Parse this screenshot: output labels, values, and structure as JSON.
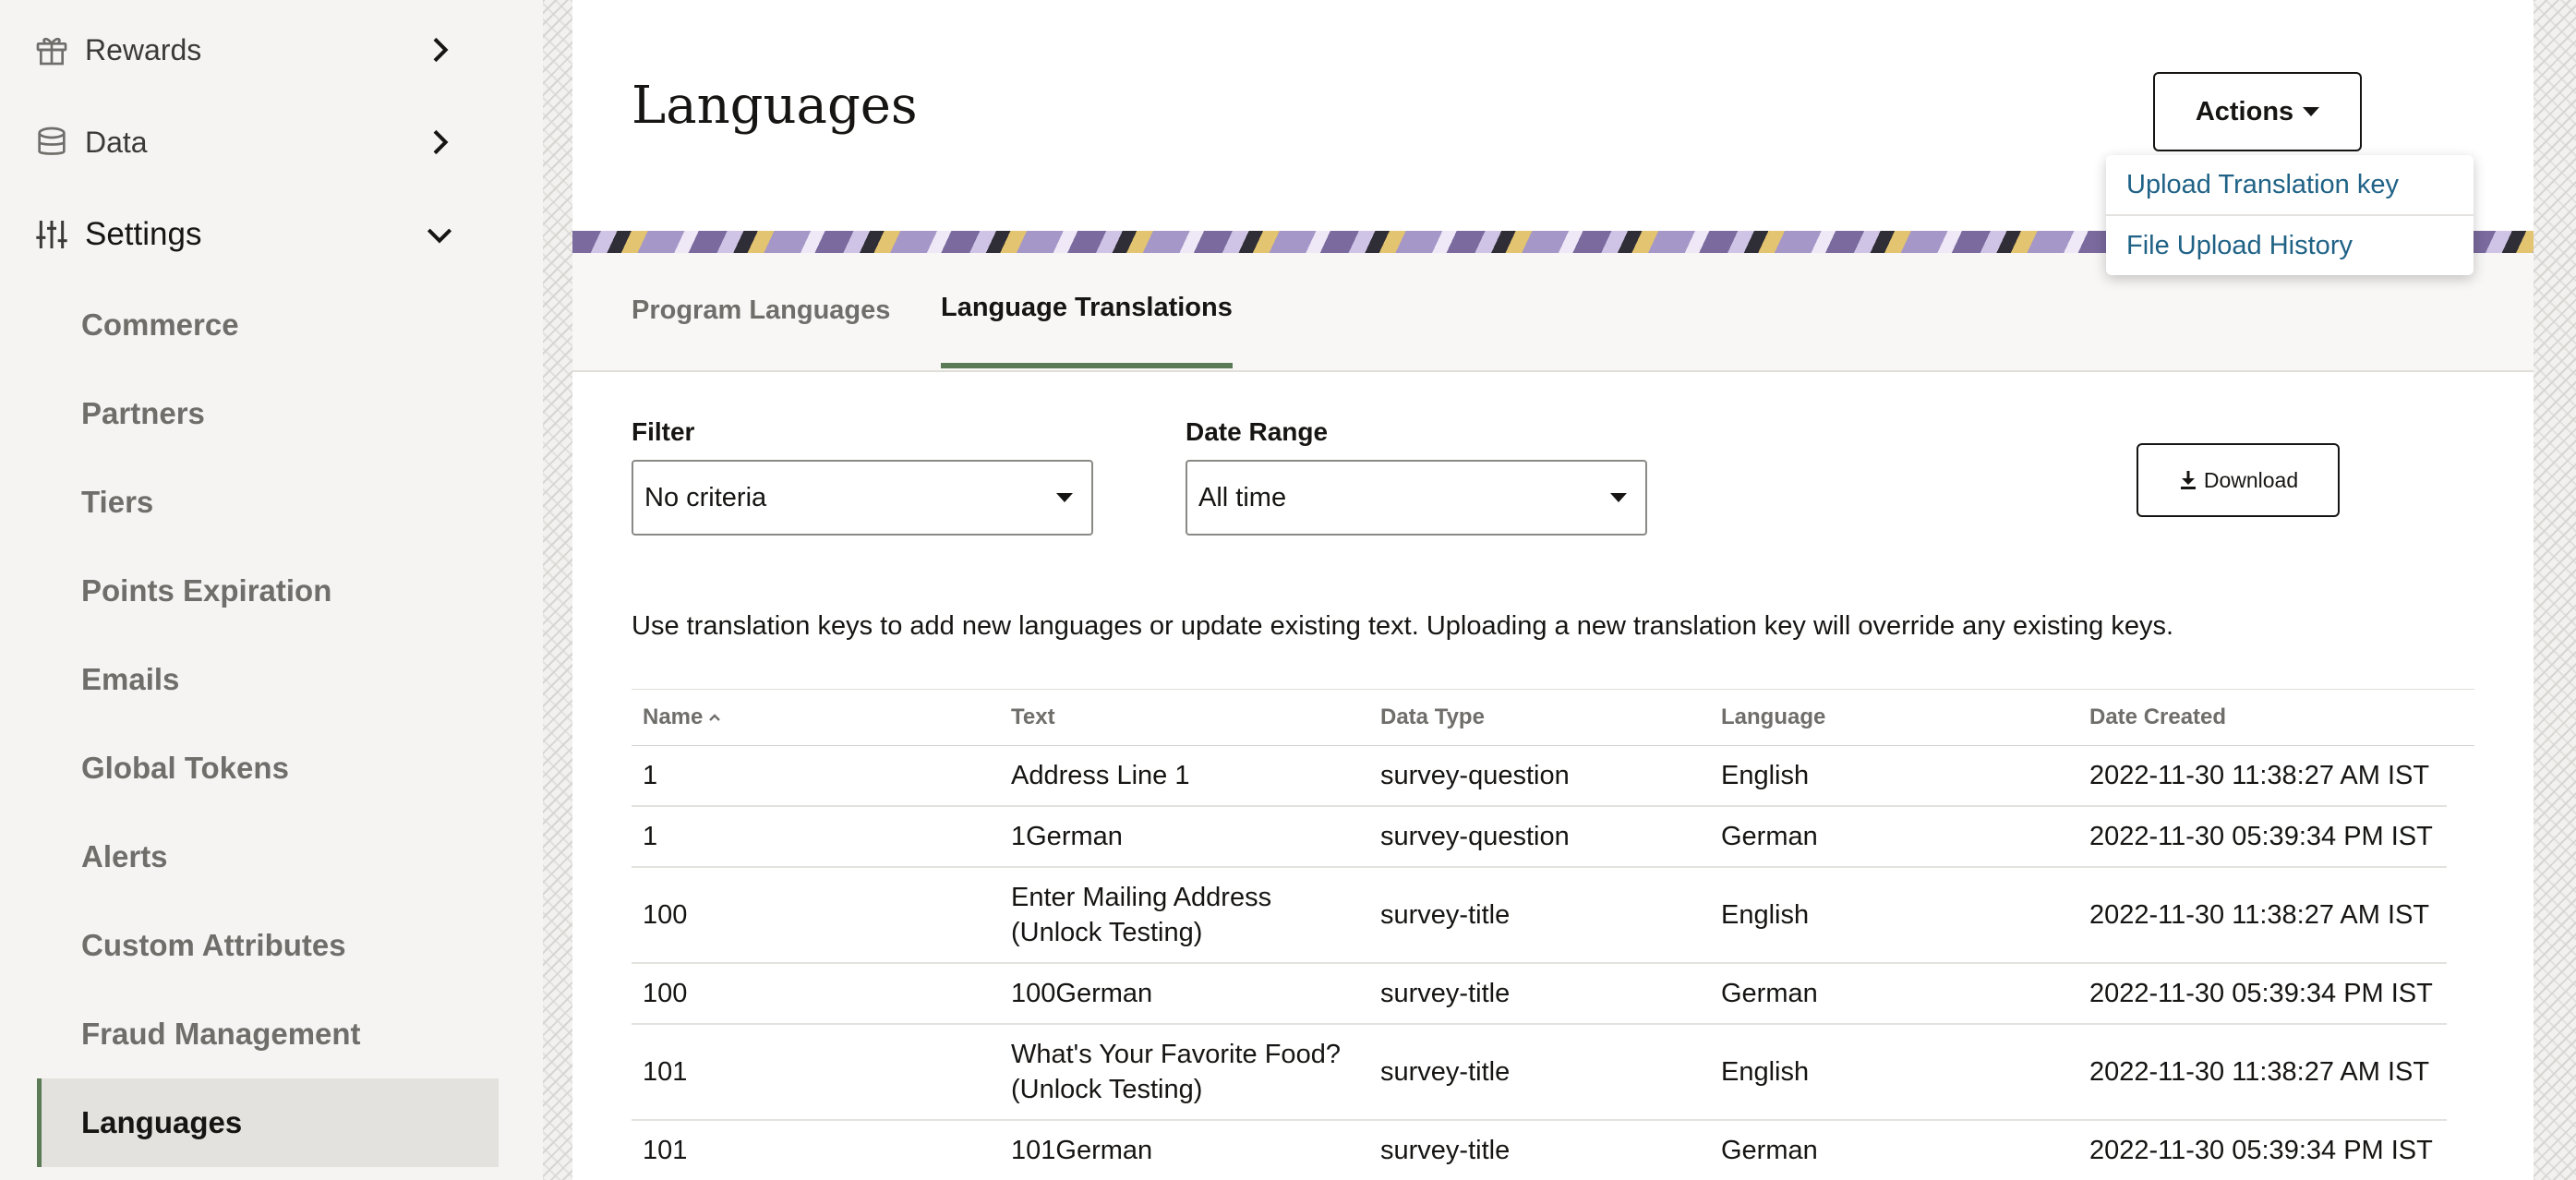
{
  "sidebar": {
    "top_items": [
      {
        "label": "Rewards",
        "icon": "gift-icon",
        "chevron": "chevron-right-icon"
      },
      {
        "label": "Data",
        "icon": "database-icon",
        "chevron": "chevron-right-icon"
      },
      {
        "label": "Settings",
        "icon": "sliders-icon",
        "chevron": "chevron-down-icon"
      }
    ],
    "settings_items": [
      {
        "label": "Commerce"
      },
      {
        "label": "Partners"
      },
      {
        "label": "Tiers"
      },
      {
        "label": "Points Expiration"
      },
      {
        "label": "Emails"
      },
      {
        "label": "Global Tokens"
      },
      {
        "label": "Alerts"
      },
      {
        "label": "Custom Attributes"
      },
      {
        "label": "Fraud Management"
      },
      {
        "label": "Languages",
        "active": true
      }
    ]
  },
  "header": {
    "title": "Languages",
    "actions_label": "Actions",
    "actions_menu": [
      "Upload Translation key",
      "File Upload History"
    ]
  },
  "tabs": [
    {
      "label": "Program Languages",
      "active": false
    },
    {
      "label": "Language Translations",
      "active": true
    }
  ],
  "filters": {
    "filter_label": "Filter",
    "filter_value": "No criteria",
    "date_range_label": "Date Range",
    "date_range_value": "All time",
    "download_label": "Download"
  },
  "info_text": "Use translation keys to add new languages or update existing text. Uploading a new translation key will override any existing keys.",
  "table": {
    "columns": [
      "Name",
      "Text",
      "Data Type",
      "Language",
      "Date Created"
    ],
    "sort": {
      "column": "Name",
      "direction": "ascending"
    },
    "rows": [
      {
        "name": "1",
        "text": "Address Line 1",
        "data_type": "survey-question",
        "language": "English",
        "date_created": "2022-11-30 11:38:27 AM IST"
      },
      {
        "name": "1",
        "text": "1German",
        "data_type": "survey-question",
        "language": "German",
        "date_created": "2022-11-30 05:39:34 PM IST"
      },
      {
        "name": "100",
        "text": "Enter Mailing Address (Unlock Testing)",
        "data_type": "survey-title",
        "language": "English",
        "date_created": "2022-11-30 11:38:27 AM IST"
      },
      {
        "name": "100",
        "text": "100German",
        "data_type": "survey-title",
        "language": "German",
        "date_created": "2022-11-30 05:39:34 PM IST"
      },
      {
        "name": "101",
        "text": "What's Your Favorite Food? (Unlock Testing)",
        "data_type": "survey-title",
        "language": "English",
        "date_created": "2022-11-30 11:38:27 AM IST"
      },
      {
        "name": "101",
        "text": "101German",
        "data_type": "survey-title",
        "language": "German",
        "date_created": "2022-11-30 05:39:34 PM IST"
      }
    ]
  },
  "colors": {
    "accent_green": "#5b7b56",
    "link_blue": "#1f6286",
    "text_primary": "#161513",
    "text_muted": "#6f6e6b"
  }
}
